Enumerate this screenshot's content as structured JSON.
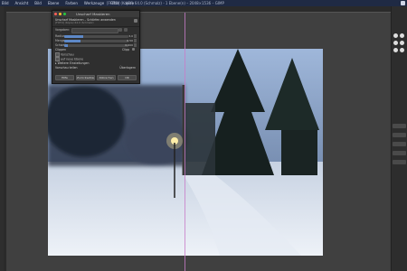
{
  "menubar": {
    "items": [
      "Bild",
      "Ansicht",
      "Bild",
      "Ebene",
      "Farben",
      "Werkzeuge",
      "Filter",
      "Hilfe"
    ],
    "window_title": "[FOTO] (Kopie) 64.0 (Schmalz) - 1 Ebene(n) – 2048×1536 – GIMP"
  },
  "dialog": {
    "title": "Unscharf Maskieren",
    "header_line": "Unscharf Maskieren – Schärfen anwenden",
    "header_sub": "[FOTO] (Kopie) 64.0 (Schmalz)",
    "presets_label": "Vorgaben:",
    "params": [
      {
        "label": "Radius",
        "value": "3,0",
        "fill": 0.3
      },
      {
        "label": "Menge",
        "value": "0,50",
        "fill": 0.25
      },
      {
        "label": "Schwelle",
        "value": "0,000",
        "fill": 0.05
      }
    ],
    "clip_label": "Clippen",
    "clip_value": "Clipp",
    "checkbox_preview": "Vorschau",
    "checkbox_merge": "auf neue Ebene",
    "expander": "Weitere Einstellungen",
    "split_label": "Vorschau teilen",
    "split_value": "Überlagern",
    "buttons": [
      "Hilfe",
      "Zurücksetzen",
      "Abbrechen",
      "OK"
    ]
  },
  "colors": {
    "menubar": "#1f2a44",
    "accent": "#5d88c7",
    "split_line": "#c87cc8"
  }
}
